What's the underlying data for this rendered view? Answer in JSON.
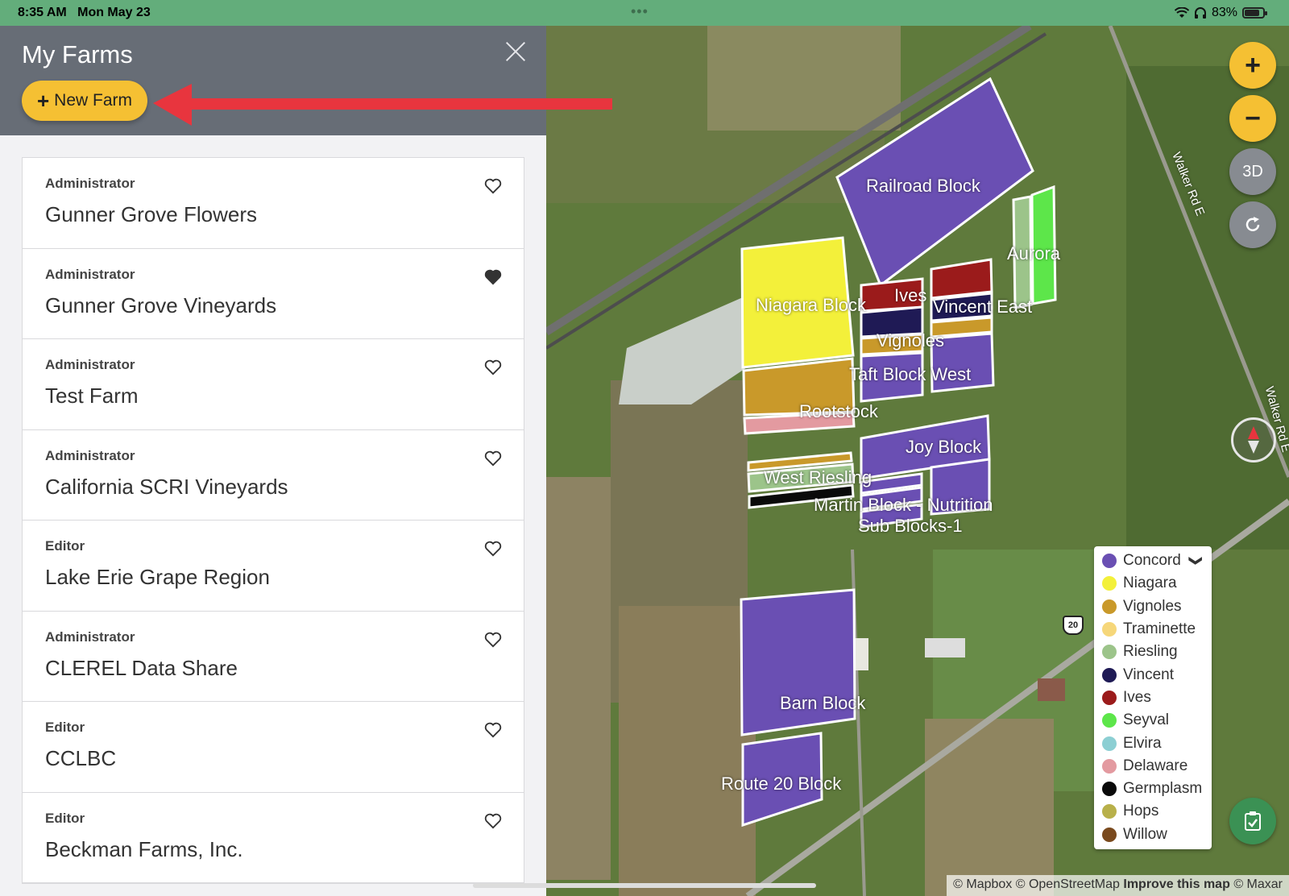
{
  "status_bar": {
    "time": "8:35 AM",
    "date": "Mon May 23",
    "battery": "83%",
    "battery_level": 0.83
  },
  "sidebar": {
    "title": "My Farms",
    "new_farm_label": "New Farm",
    "farms": [
      {
        "role": "Administrator",
        "name": "Gunner Grove Flowers",
        "favorite": false
      },
      {
        "role": "Administrator",
        "name": "Gunner Grove Vineyards",
        "favorite": true
      },
      {
        "role": "Administrator",
        "name": "Test Farm",
        "favorite": false
      },
      {
        "role": "Administrator",
        "name": "California SCRI Vineyards",
        "favorite": false
      },
      {
        "role": "Editor",
        "name": "Lake Erie Grape Region",
        "favorite": false
      },
      {
        "role": "Administrator",
        "name": "CLEREL Data Share",
        "favorite": false
      },
      {
        "role": "Editor",
        "name": "CCLBC",
        "favorite": false
      },
      {
        "role": "Editor",
        "name": "Beckman Farms, Inc.",
        "favorite": false
      }
    ]
  },
  "map": {
    "controls": {
      "zoom_in": "+",
      "zoom_out": "−",
      "view_3d": "3D"
    },
    "road_labels": [
      "Walker Rd E",
      "Walker Rd E"
    ],
    "route_shield": "20",
    "blocks": [
      "Railroad Block",
      "Aurora",
      "Niagara Block",
      "Ives",
      "Vincent East",
      "Vignoles",
      "Taft Block West",
      "Rootstock",
      "Joy Block",
      "West Riesling",
      "Martin Block - Nutrition",
      "Sub Blocks-1",
      "Barn Block",
      "Route 20 Block"
    ],
    "legend": [
      {
        "label": "Concord",
        "color": "#6a4fb3"
      },
      {
        "label": "Niagara",
        "color": "#f3f03a"
      },
      {
        "label": "Vignoles",
        "color": "#c9992a"
      },
      {
        "label": "Traminette",
        "color": "#f6d77a"
      },
      {
        "label": "Riesling",
        "color": "#9cc48a"
      },
      {
        "label": "Vincent",
        "color": "#1f1a55"
      },
      {
        "label": "Ives",
        "color": "#9b1b1b"
      },
      {
        "label": "Seyval",
        "color": "#5de64a"
      },
      {
        "label": "Elvira",
        "color": "#8ccfd3"
      },
      {
        "label": "Delaware",
        "color": "#e39aa0"
      },
      {
        "label": "Germplasm",
        "color": "#0a0a0a"
      },
      {
        "label": "Hops",
        "color": "#b8b04a"
      },
      {
        "label": "Willow",
        "color": "#7a4a1e"
      }
    ],
    "attribution": {
      "text": "© Mapbox © OpenStreetMap",
      "link": "Improve this map",
      "suffix": "© Maxar"
    }
  }
}
